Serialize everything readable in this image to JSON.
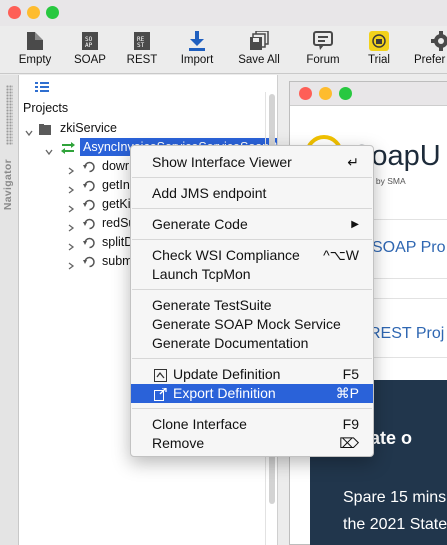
{
  "window": {
    "traffic_lights": {
      "close": "#fe5f57",
      "minimize": "#febc2e",
      "maximize": "#28c840"
    }
  },
  "toolbar": {
    "items": [
      {
        "label": "Empty",
        "icon": "empty-project-icon"
      },
      {
        "label": "SOAP",
        "icon": "soap-project-icon"
      },
      {
        "label": "REST",
        "icon": "rest-project-icon"
      },
      {
        "label": "Import",
        "icon": "import-icon"
      },
      {
        "label": "Save All",
        "icon": "save-all-icon"
      },
      {
        "label": "Forum",
        "icon": "forum-icon"
      },
      {
        "label": "Trial",
        "icon": "trial-icon"
      },
      {
        "label": "Prefer",
        "icon": "preferences-icon"
      }
    ]
  },
  "navigator": {
    "tab_label": "Navigator",
    "heading": "Projects",
    "project": "zkiService",
    "interface": "AsyncInvoiceServiceServiceSoapBi",
    "operations": [
      "dowr",
      "getIn",
      "getKi",
      "redSu",
      "splitD",
      "subm"
    ]
  },
  "context_menu": {
    "items": [
      {
        "label": "Show Interface Viewer",
        "shortcut": "↵"
      },
      {
        "label": "Add JMS endpoint",
        "shortcut": ""
      },
      {
        "label": "Generate Code",
        "shortcut": "▶"
      },
      {
        "label": "Check WSI Compliance",
        "shortcut": "^⌥W"
      },
      {
        "label": "Launch TcpMon",
        "shortcut": ""
      },
      {
        "label": "Generate TestSuite",
        "shortcut": ""
      },
      {
        "label": "Generate SOAP Mock Service",
        "shortcut": ""
      },
      {
        "label": "Generate Documentation",
        "shortcut": ""
      },
      {
        "label": "Update Definition",
        "shortcut": "F5"
      },
      {
        "label": "Export Definition",
        "shortcut": "⌘P"
      },
      {
        "label": "Clone Interface",
        "shortcut": "F9"
      },
      {
        "label": "Remove",
        "shortcut": "⌦"
      }
    ],
    "highlighted": "Export Definition",
    "highlight_color": "#2a62d9"
  },
  "inner_window": {
    "logo_text": "SoapU",
    "logo_sub": "upported by SMA",
    "promo1": "SOAP Pro",
    "promo2": "REST Proj",
    "banner_head": "e State o",
    "banner_lines": [
      "Spare 15 mins",
      "the 2021 State"
    ]
  }
}
